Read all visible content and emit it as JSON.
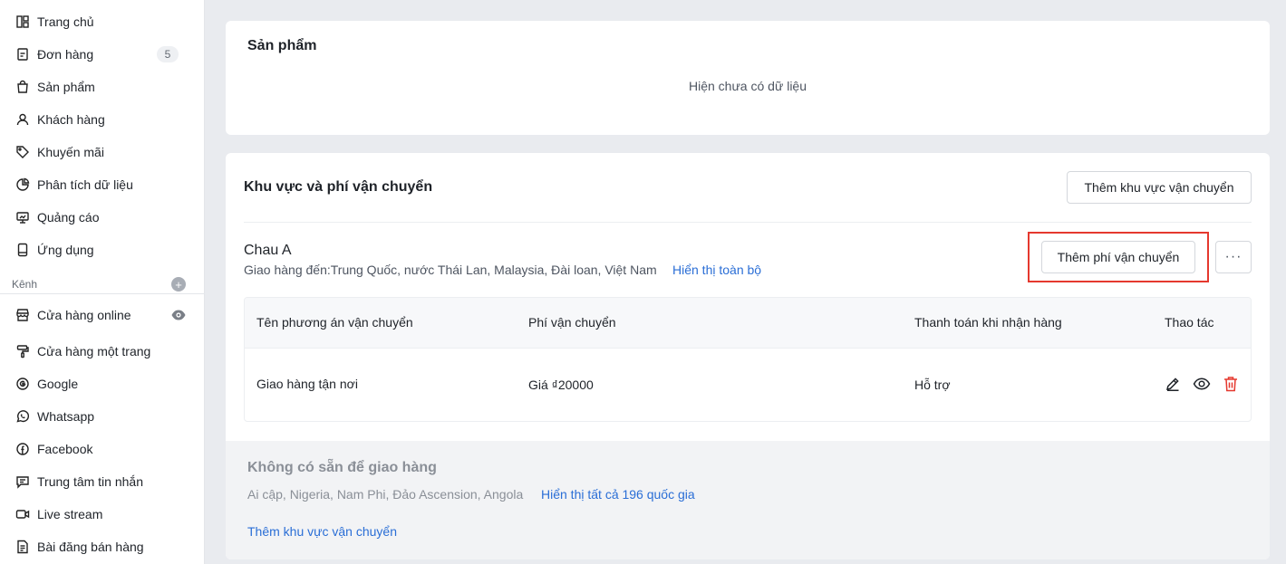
{
  "sidebar": {
    "items": [
      {
        "label": "Trang chủ",
        "icon": "dashboard-icon"
      },
      {
        "label": "Đơn hàng",
        "icon": "orders-icon",
        "badge": "5"
      },
      {
        "label": "Sản phẩm",
        "icon": "bag-icon"
      },
      {
        "label": "Khách hàng",
        "icon": "user-icon"
      },
      {
        "label": "Khuyến mãi",
        "icon": "tag-icon"
      },
      {
        "label": "Phân tích dữ liệu",
        "icon": "pie-chart-icon"
      },
      {
        "label": "Quảng cáo",
        "icon": "monitor-icon"
      },
      {
        "label": "Ứng dụng",
        "icon": "app-icon"
      }
    ],
    "channel_header": "Kênh",
    "channels": [
      {
        "label": "Cửa hàng online",
        "icon": "store-icon"
      },
      {
        "label": "Cửa hàng một trang",
        "icon": "brush-icon"
      },
      {
        "label": "Google",
        "icon": "google-icon"
      },
      {
        "label": "Whatsapp",
        "icon": "whatsapp-icon"
      },
      {
        "label": "Facebook",
        "icon": "facebook-icon"
      },
      {
        "label": "Trung tâm tin nhắn",
        "icon": "message-icon"
      },
      {
        "label": "Live stream",
        "icon": "video-icon"
      },
      {
        "label": "Bài đăng bán hàng",
        "icon": "post-icon"
      }
    ]
  },
  "products": {
    "title": "Sản phẩm",
    "empty": "Hiện chưa có dữ liệu"
  },
  "shipping": {
    "title": "Khu vực và phí vận chuyển",
    "add_zone_button": "Thêm khu vực vận chuyển",
    "zone": {
      "name": "Chau A",
      "destinations": "Giao hàng đến:Trung Quốc, nước Thái Lan, Malaysia, Đài loan, Việt Nam",
      "show_all": "Hiển thị toàn bộ",
      "add_fee_button": "Thêm phí vận chuyển",
      "more_button": "···"
    },
    "table": {
      "headers": [
        "Tên phương án vận chuyển",
        "Phí vận chuyển",
        "Thanh toán khi nhận hàng",
        "Thao tác"
      ],
      "rows": [
        {
          "method": "Giao hàng tận nơi",
          "fee": "Giá ₫20000",
          "cod": "Hỗ trợ"
        }
      ]
    },
    "unavailable": {
      "title": "Không có sẵn để giao hàng",
      "countries": "Ai cập, Nigeria, Nam Phi, Đảo Ascension, Angola",
      "show_all": "Hiển thị tất cả 196 quốc gia",
      "add_zone": "Thêm khu vực vận chuyển"
    }
  },
  "colors": {
    "link": "#2a6ed6",
    "highlight": "#e5382e",
    "delete": "#e5382e"
  }
}
